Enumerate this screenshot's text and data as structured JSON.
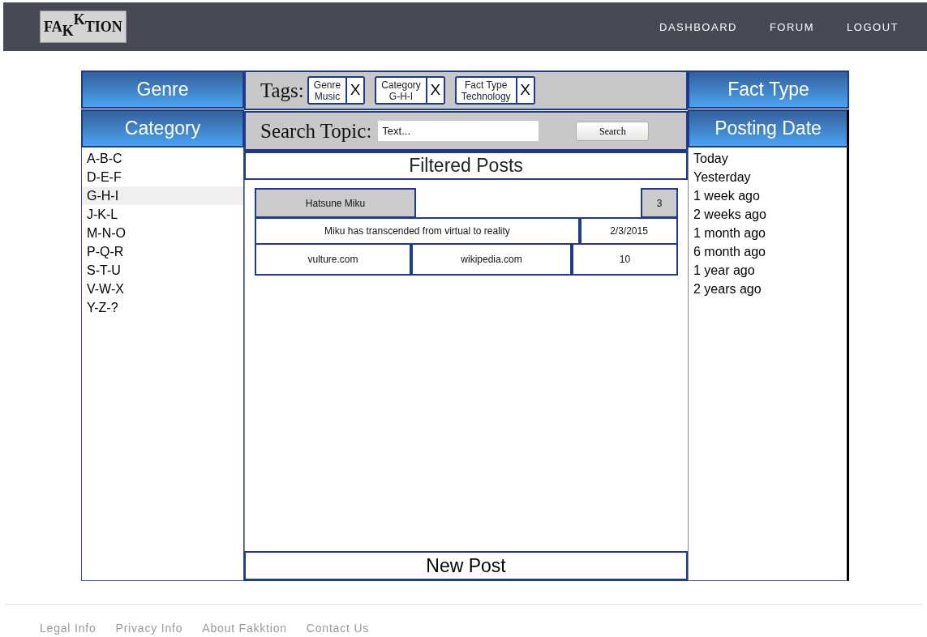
{
  "navbar": {
    "logo": "FA$_{K}$$^{K}$TION",
    "links": [
      "DASHBOARD",
      "FORUM",
      "LOGOUT"
    ]
  },
  "left": {
    "genre_header": "Genre",
    "category_header": "Category",
    "categories": [
      {
        "label": "A-B-C",
        "selected": false
      },
      {
        "label": "D-E-F",
        "selected": false
      },
      {
        "label": "G-H-I",
        "selected": true
      },
      {
        "label": "J-K-L",
        "selected": false
      },
      {
        "label": "M-N-O",
        "selected": false
      },
      {
        "label": "P-Q-R",
        "selected": false
      },
      {
        "label": "S-T-U",
        "selected": false
      },
      {
        "label": "V-W-X",
        "selected": false
      },
      {
        "label": "Y-Z-?",
        "selected": false
      }
    ]
  },
  "tags": {
    "label": "Tags:",
    "items": [
      {
        "line_1": "Genre",
        "line_2": "Music",
        "remove": "X"
      },
      {
        "line_1": "Category",
        "line_2": "G-H-I",
        "remove": "X"
      },
      {
        "line_1": "Fact Type",
        "line_2": "Technology",
        "remove": "X"
      }
    ]
  },
  "search": {
    "label": "Search Topic:",
    "placeholder": "Text...",
    "button": "Search"
  },
  "posts_header": "Filtered Posts",
  "posts": [
    {
      "author": "Hatsune Miku",
      "count": "3",
      "title": "Miku has transcended from virtual to reality",
      "date": "2/3/2015",
      "source_1": "vulture.com",
      "source_2": "wikipedia.com",
      "score": "10"
    }
  ],
  "new_post": "New Post",
  "right": {
    "fact_type_header": "Fact Type",
    "posting_date_header": "Posting Date",
    "dates": [
      "Today",
      "Yesterday",
      "1 week ago",
      "2 weeks ago",
      "1 month ago",
      "6 month ago",
      "1 year ago",
      "2 years ago"
    ]
  },
  "footer": {
    "links": [
      "Legal Info",
      "Privacy Info",
      "About Fakktion",
      "Contact Us"
    ]
  }
}
